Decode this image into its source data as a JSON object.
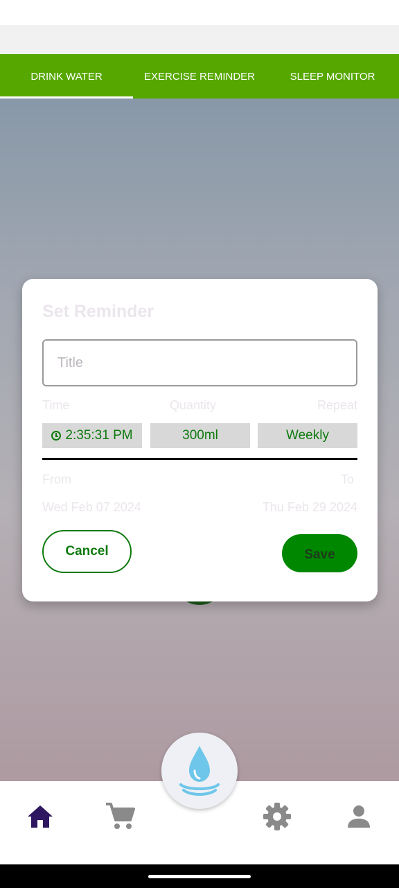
{
  "tabs": [
    {
      "label": "DRINK WATER",
      "active": true
    },
    {
      "label": "EXERCISE REMINDER",
      "active": false
    },
    {
      "label": "SLEEP MONITOR",
      "active": false
    }
  ],
  "dialog": {
    "title": "Set Reminder",
    "title_placeholder": "Title",
    "labels": {
      "time": "Time",
      "quantity": "Quantity",
      "repeat": "Repeat",
      "from": "From",
      "to": "To"
    },
    "time_value": "2:35:31 PM",
    "quantity_value": "300ml",
    "repeat_value": "Weekly",
    "from_date": "Wed Feb 07 2024",
    "to_date": "Thu Feb 29 2024",
    "cancel_label": "Cancel",
    "save_label": "Save"
  },
  "bottom_nav": {
    "items": [
      {
        "icon": "home-icon",
        "active": true
      },
      {
        "icon": "cart-icon",
        "active": false
      },
      {
        "icon": "water-drop-icon",
        "active": false
      },
      {
        "icon": "settings-icon",
        "active": false
      },
      {
        "icon": "profile-icon",
        "active": false
      }
    ]
  },
  "colors": {
    "accent_green": "#56a800",
    "dark_green": "#0d7a0d",
    "save_green": "#008700",
    "active_nav": "#2e1760",
    "inactive_nav": "#8a8a8a",
    "water_blue": "#6ec6ea"
  }
}
